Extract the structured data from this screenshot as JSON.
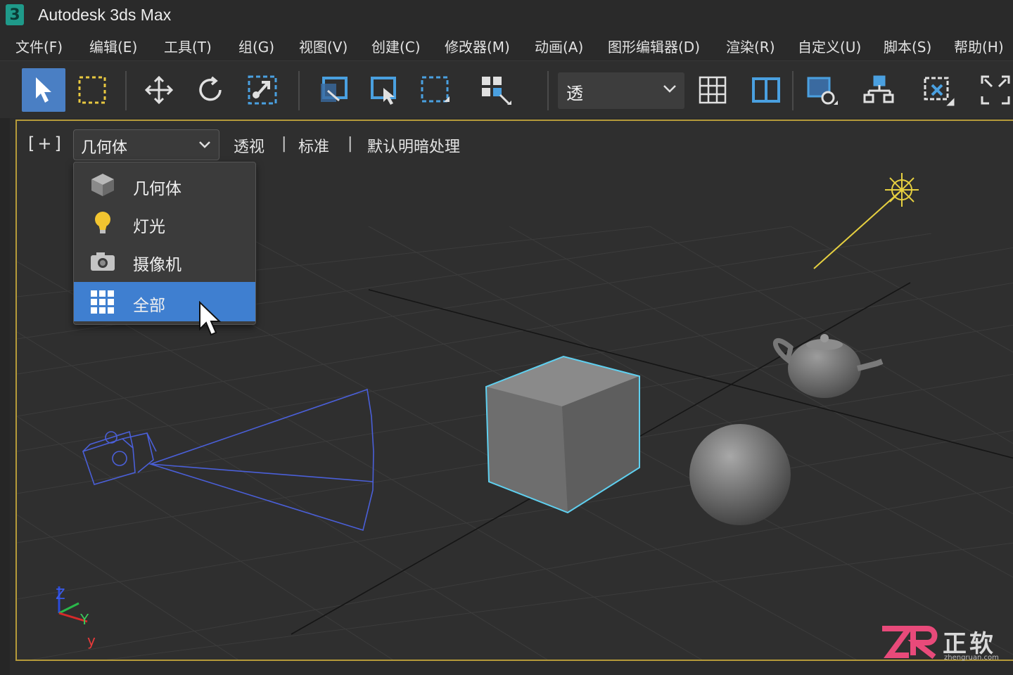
{
  "window": {
    "title": "Autodesk 3ds Max",
    "logo_text": "3"
  },
  "menu": [
    {
      "label": "文件(F)"
    },
    {
      "label": "编辑(E)"
    },
    {
      "label": "工具(T)"
    },
    {
      "label": "组(G)"
    },
    {
      "label": "视图(V)"
    },
    {
      "label": "创建(C)"
    },
    {
      "label": "修改器(M)"
    },
    {
      "label": "动画(A)"
    },
    {
      "label": "图形编辑器(D)"
    },
    {
      "label": "渲染(R)"
    },
    {
      "label": "自定义(U)"
    },
    {
      "label": "脚本(S)"
    },
    {
      "label": "帮助(H)"
    }
  ],
  "toolbar": {
    "viewport_select_value": "透",
    "icons": [
      "select-arrow-icon",
      "rect-select-icon",
      "move-icon",
      "rotate-icon",
      "scale-select-icon",
      "select-region-icon",
      "select-by-name-icon",
      "window-crossing-icon",
      "snap-grid-icon",
      "grid-layout-icon",
      "viewport-layout-icon",
      "render-setup-icon",
      "schematic-icon",
      "material-editor-icon",
      "maximize-icon"
    ]
  },
  "viewport": {
    "plus_label": "[+]",
    "filter_value": "几何体",
    "options": [
      "透视",
      "标准",
      "默认明暗处理"
    ],
    "separator": "|",
    "filter_menu": [
      {
        "label": "几何体",
        "icon": "cube-icon",
        "selected": false
      },
      {
        "label": "灯光",
        "icon": "bulb-icon",
        "selected": false
      },
      {
        "label": "摄像机",
        "icon": "camera-icon",
        "selected": false
      },
      {
        "label": "全部",
        "icon": "grid-all-icon",
        "selected": true
      }
    ],
    "axis": {
      "z": "Z",
      "y": "Y",
      "x": "y"
    }
  },
  "colors": {
    "accent": "#3f7fd0",
    "viewport_border": "#b59a3a",
    "camera_wire": "#4a5fd8",
    "selection_outline": "#5fd0f0",
    "light_line": "#e6d040"
  },
  "watermark": {
    "brand": "正软",
    "url": "zhengruan.com"
  }
}
